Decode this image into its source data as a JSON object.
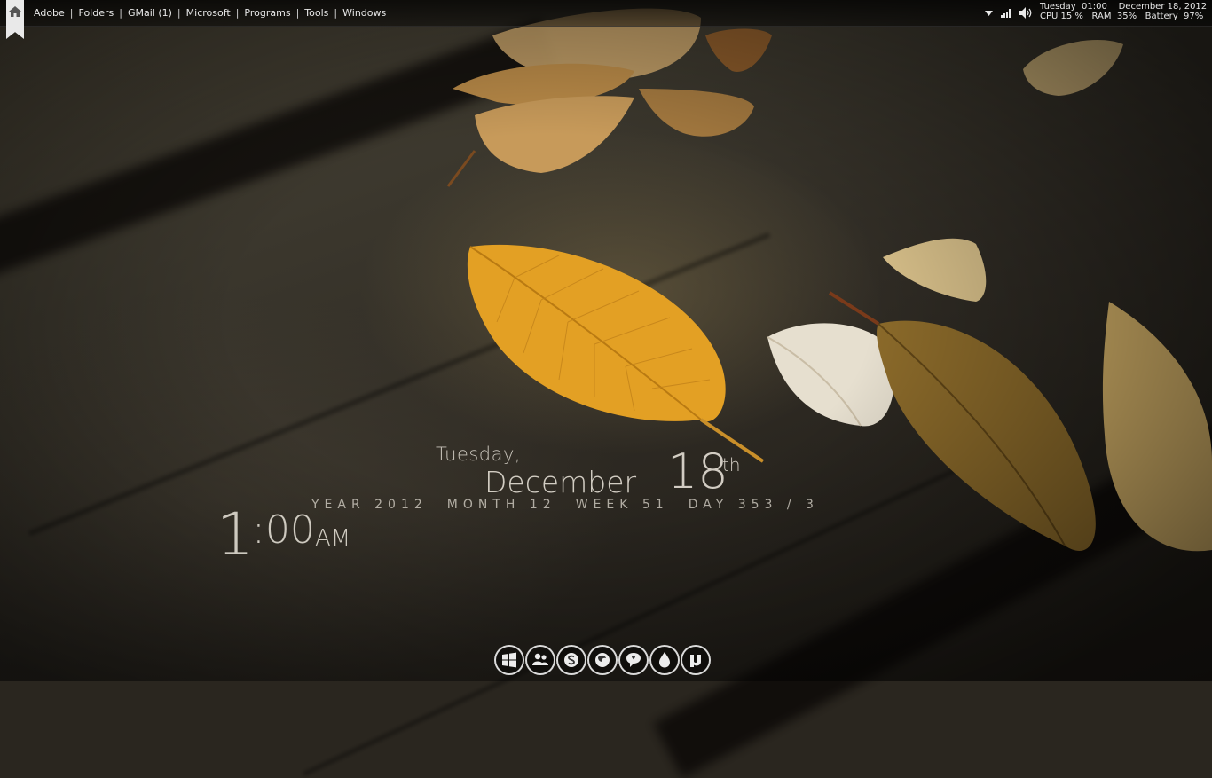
{
  "menu": {
    "items": [
      "Adobe",
      "Folders",
      "GMail (1)",
      "Microsoft",
      "Programs",
      "Tools",
      "Windows"
    ],
    "separator": "|"
  },
  "tray": {
    "icons": [
      "dropdown-arrow-icon",
      "signal-bars-icon",
      "volume-icon"
    ]
  },
  "sysinfo": {
    "weekday": "Tuesday",
    "time": "01:00",
    "date": "December 18, 2012",
    "cpu_label": "CPU",
    "cpu_value": "15 %",
    "ram_label": "RAM",
    "ram_value": "35%",
    "battery_label": "Battery",
    "battery_value": "97%"
  },
  "clock": {
    "weekday": "Tuesday,",
    "month": "December",
    "day": "18",
    "suffix": "th",
    "year": "YEAR 2012",
    "month_num": "MONTH 12",
    "week": "WEEK 51",
    "day_of_year": "DAY 353 / 3",
    "hour": "1",
    "minutes": ":00",
    "ampm": "AM"
  },
  "dock": {
    "icons": [
      "windows-icon",
      "messenger-icon",
      "skype-icon",
      "firefox-icon",
      "chat-bubble-icon",
      "droplet-icon",
      "utorrent-icon"
    ]
  },
  "colors": {
    "text": "#e8e8e8",
    "leaf_gold": "#e3a024",
    "wood": "#3b372d"
  }
}
